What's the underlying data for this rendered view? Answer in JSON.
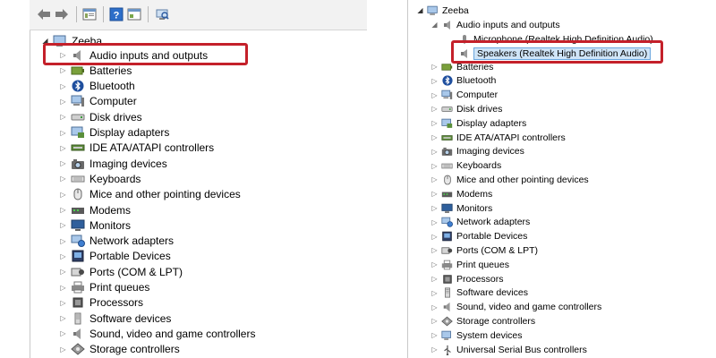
{
  "left": {
    "toolbar": {
      "back_icon": "arrow-left-icon",
      "forward_icon": "arrow-right-icon",
      "properties_icon": "properties-icon",
      "help_icon": "help-icon",
      "view_icon": "view-icon",
      "scan_icon": "scan-hardware-icon"
    },
    "root": "Zeeba",
    "items": [
      "Audio inputs and outputs",
      "Batteries",
      "Bluetooth",
      "Computer",
      "Disk drives",
      "Display adapters",
      "IDE ATA/ATAPI controllers",
      "Imaging devices",
      "Keyboards",
      "Mice and other pointing devices",
      "Modems",
      "Monitors",
      "Network adapters",
      "Portable Devices",
      "Ports (COM & LPT)",
      "Print queues",
      "Processors",
      "Software devices",
      "Sound, video and game controllers",
      "Storage controllers"
    ]
  },
  "right": {
    "root": "Zeeba",
    "audio_parent": "Audio inputs and outputs",
    "audio_children": [
      "Microphone (Realtek High Definition Audio)",
      "Speakers (Realtek High Definition Audio)"
    ],
    "items": [
      "Batteries",
      "Bluetooth",
      "Computer",
      "Disk drives",
      "Display adapters",
      "IDE ATA/ATAPI controllers",
      "Imaging devices",
      "Keyboards",
      "Mice and other pointing devices",
      "Modems",
      "Monitors",
      "Network adapters",
      "Portable Devices",
      "Ports (COM & LPT)",
      "Print queues",
      "Processors",
      "Software devices",
      "Sound, video and game controllers",
      "Storage controllers",
      "System devices",
      "Universal Serial Bus controllers"
    ]
  },
  "colors": {
    "highlight": "#c4202a",
    "selection": "#cfe4f7"
  }
}
